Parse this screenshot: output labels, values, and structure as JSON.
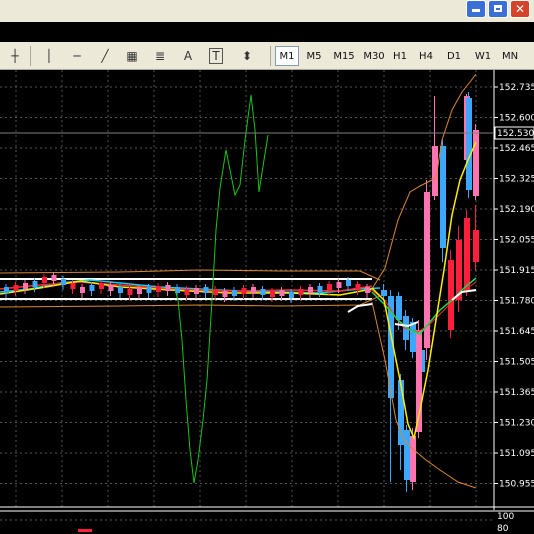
{
  "window": {
    "buttons": [
      {
        "name": "minimize-button",
        "glyph": "_"
      },
      {
        "name": "restore-button",
        "glyph": "❐"
      },
      {
        "name": "close-button",
        "glyph": "✕"
      }
    ]
  },
  "toolbar": {
    "tools": [
      {
        "name": "crosshair-icon",
        "glyph": "┼"
      },
      {
        "name": "vertical-line-icon",
        "glyph": "│"
      },
      {
        "name": "horizontal-line-icon",
        "glyph": "─"
      },
      {
        "name": "trendline-icon",
        "glyph": "╱"
      },
      {
        "name": "equidistant-channel-icon",
        "glyph": "▦"
      },
      {
        "name": "fibonacci-icon",
        "glyph": "≣"
      },
      {
        "name": "text-icon",
        "glyph": "A"
      },
      {
        "name": "text-label-icon",
        "glyph": "T"
      },
      {
        "name": "arrows-icon",
        "glyph": "⬍"
      }
    ],
    "timeframes": [
      "M1",
      "M5",
      "M15",
      "M30",
      "H1",
      "H4",
      "D1",
      "W1",
      "MN"
    ],
    "active_timeframe": "M1"
  },
  "price_axis": {
    "labels": [
      "152.735",
      "152.600",
      "152.465",
      "152.325",
      "152.190",
      "152.055",
      "151.915",
      "151.780",
      "151.645",
      "151.505",
      "151.365",
      "151.230",
      "151.095",
      "150.955"
    ],
    "current_price": "152.530",
    "sub_window_labels": [
      "100",
      "80"
    ]
  },
  "colors": {
    "bull_candle": "#3ba7ff",
    "bear_candle": "#ff1f3a",
    "pink_candle": "#ff74b0",
    "fast_ma": "#ffee00",
    "green_line": "#19c419",
    "envelope": "#d9882f"
  }
}
